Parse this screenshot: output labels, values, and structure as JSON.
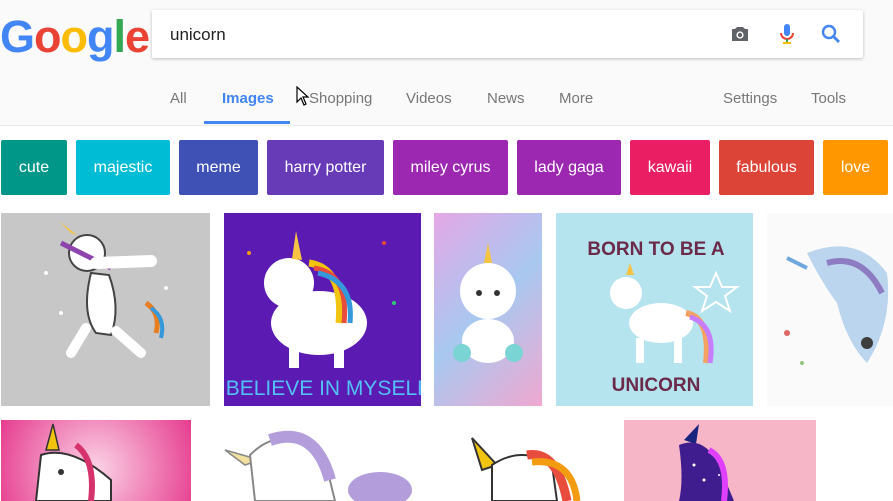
{
  "logo": {
    "letters": [
      "G",
      "o",
      "o",
      "g",
      "l",
      "e"
    ],
    "colors": [
      "#4285f4",
      "#ea4335",
      "#fbbc05",
      "#4285f4",
      "#34a853",
      "#ea4335"
    ]
  },
  "search": {
    "query": "unicorn",
    "icons": [
      "camera-icon",
      "microphone-icon",
      "search-icon"
    ]
  },
  "tabs": [
    {
      "label": "All"
    },
    {
      "label": "Images",
      "active": true
    },
    {
      "label": "Shopping"
    },
    {
      "label": "Videos"
    },
    {
      "label": "News"
    },
    {
      "label": "More"
    },
    {
      "label": "Settings"
    },
    {
      "label": "Tools"
    }
  ],
  "chips": [
    {
      "label": "cute",
      "color": "#009688"
    },
    {
      "label": "majestic",
      "color": "#00bcd4"
    },
    {
      "label": "meme",
      "color": "#3f51b5"
    },
    {
      "label": "harry potter",
      "color": "#673ab7"
    },
    {
      "label": "miley cyrus",
      "color": "#9c27b0"
    },
    {
      "label": "lady gaga",
      "color": "#9c27b0"
    },
    {
      "label": "kawaii",
      "color": "#e91e63"
    },
    {
      "label": "fabulous",
      "color": "#db4437"
    },
    {
      "label": "love",
      "color": "#ff9800"
    }
  ],
  "results": {
    "image2_caption": "I BELIEVE IN MYSELF",
    "image4_top_text": "BORN TO BE A",
    "image4_bottom_text": "UNICORN"
  },
  "colors": {
    "accent": "#4285f4",
    "tab_text": "#777777"
  }
}
